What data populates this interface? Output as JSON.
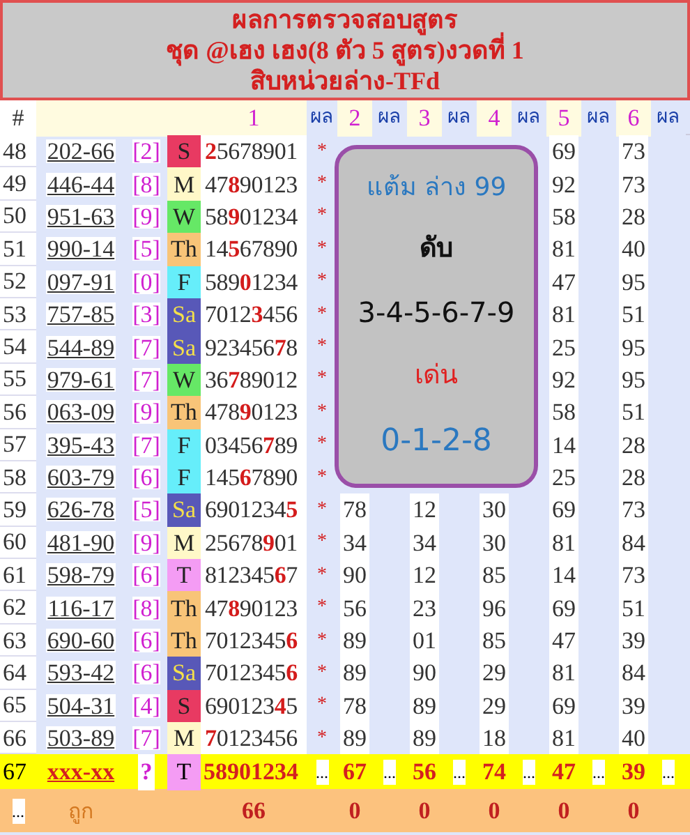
{
  "title_lines": [
    "ผลการตรวจสอบสูตร",
    "ชุด @เฮง เฮง(8 ตัว 5 สูตร)งวดที่ 1",
    "สิบหน่วยล่าง-TFd"
  ],
  "header": [
    {
      "label": "#",
      "kind": "index"
    },
    {
      "label": "1",
      "kind": "number"
    },
    {
      "label": "ผล",
      "kind": "result"
    },
    {
      "label": "2",
      "kind": "number"
    },
    {
      "label": "ผล",
      "kind": "result"
    },
    {
      "label": "3",
      "kind": "number"
    },
    {
      "label": "ผล",
      "kind": "result"
    },
    {
      "label": "4",
      "kind": "number"
    },
    {
      "label": "ผล",
      "kind": "result"
    },
    {
      "label": "5",
      "kind": "number"
    },
    {
      "label": "ผล",
      "kind": "result"
    },
    {
      "label": "6",
      "kind": "number"
    },
    {
      "label": "ผล",
      "kind": "result"
    }
  ],
  "rows": [
    {
      "no": "48",
      "pair": "202-66",
      "digit": "[2]",
      "day": {
        "label": "S",
        "color": "#e83a62"
      },
      "digits": {
        "hit": "2",
        "post": "5678901"
      },
      "mark": "*",
      "results": [
        "69",
        "73"
      ]
    },
    {
      "no": "49",
      "pair": "446-44",
      "digit": "[8]",
      "day": {
        "label": "M",
        "color": "#fff8c8"
      },
      "digits": {
        "pre": "47",
        "hit": "8",
        "post": "90123"
      },
      "mark": "*",
      "results": [
        "92",
        "73"
      ]
    },
    {
      "no": "50",
      "pair": "951-63",
      "digit": "[9]",
      "day": {
        "label": "W",
        "color": "#66e866"
      },
      "digits": {
        "pre": "58",
        "hit": "9",
        "post": "01234"
      },
      "mark": "*",
      "results": [
        "58",
        "28"
      ]
    },
    {
      "no": "51",
      "pair": "990-14",
      "digit": "[5]",
      "day": {
        "label": "Th",
        "color": "#f8c478"
      },
      "digits": {
        "pre": "14",
        "hit": "5",
        "post": "67890"
      },
      "mark": "*",
      "results": [
        "81",
        "40"
      ]
    },
    {
      "no": "52",
      "pair": "097-91",
      "digit": "[0]",
      "day": {
        "label": "F",
        "color": "#66eefa"
      },
      "digits": {
        "pre": "589",
        "hit": "0",
        "post": "1234"
      },
      "mark": "*",
      "results": [
        "47",
        "95"
      ]
    },
    {
      "no": "53",
      "pair": "757-85",
      "digit": "[3]",
      "day": {
        "label": "Sa",
        "color": "#5858b8"
      },
      "digits": {
        "pre": "7012",
        "hit": "3",
        "post": "456"
      },
      "mark": "*",
      "results": [
        "81",
        "51"
      ]
    },
    {
      "no": "54",
      "pair": "544-89",
      "digit": "[7]",
      "day": {
        "label": "Sa",
        "color": "#5858b8"
      },
      "digits": {
        "pre": "923456",
        "hit": "7",
        "post": "8"
      },
      "mark": "*",
      "results": [
        "25",
        "95"
      ]
    },
    {
      "no": "55",
      "pair": "979-61",
      "digit": "[7]",
      "day": {
        "label": "W",
        "color": "#66e866"
      },
      "digits": {
        "pre": "36",
        "hit": "7",
        "post": "89012"
      },
      "mark": "*",
      "results": [
        "92",
        "95"
      ]
    },
    {
      "no": "56",
      "pair": "063-09",
      "digit": "[9]",
      "day": {
        "label": "Th",
        "color": "#f8c478"
      },
      "digits": {
        "pre": "478",
        "hit": "9",
        "post": "0123"
      },
      "mark": "*",
      "results": [
        "58",
        "51"
      ]
    },
    {
      "no": "57",
      "pair": "395-43",
      "digit": "[7]",
      "day": {
        "label": "F",
        "color": "#66eefa"
      },
      "digits": {
        "pre": "03456",
        "hit": "7",
        "post": "89"
      },
      "mark": "*",
      "results": [
        "14",
        "28"
      ]
    },
    {
      "no": "58",
      "pair": "603-79",
      "digit": "[6]",
      "day": {
        "label": "F",
        "color": "#66eefa"
      },
      "digits": {
        "pre": "145",
        "hit": "6",
        "post": "7890"
      },
      "mark": "*",
      "results": [
        "25",
        "28"
      ]
    },
    {
      "no": "59",
      "pair": "626-78",
      "digit": "[5]",
      "day": {
        "label": "Sa",
        "color": "#5858b8"
      },
      "digits": {
        "pre": "6901234",
        "hit": "5"
      },
      "mark": "*",
      "results": [
        "78",
        "12",
        "30",
        "69",
        "73"
      ]
    },
    {
      "no": "60",
      "pair": "481-90",
      "digit": "[9]",
      "day": {
        "label": "M",
        "color": "#fff8c8"
      },
      "digits": {
        "pre": "25678",
        "hit": "9",
        "post": "01"
      },
      "mark": "*",
      "results": [
        "34",
        "34",
        "30",
        "81",
        "84"
      ]
    },
    {
      "no": "61",
      "pair": "598-79",
      "digit": "[6]",
      "day": {
        "label": "T",
        "color": "#f49cf4"
      },
      "digits": {
        "pre": "812345",
        "hit": "6",
        "post": "7"
      },
      "mark": "*",
      "results": [
        "90",
        "12",
        "85",
        "14",
        "73"
      ]
    },
    {
      "no": "62",
      "pair": "116-17",
      "digit": "[8]",
      "day": {
        "label": "Th",
        "color": "#f8c478"
      },
      "digits": {
        "pre": "47",
        "hit": "8",
        "post": "90123"
      },
      "mark": "*",
      "results": [
        "56",
        "23",
        "96",
        "69",
        "51"
      ]
    },
    {
      "no": "63",
      "pair": "690-60",
      "digit": "[6]",
      "day": {
        "label": "Th",
        "color": "#f8c478"
      },
      "digits": {
        "pre": "7012345",
        "hit": "6"
      },
      "mark": "*",
      "results": [
        "89",
        "01",
        "85",
        "47",
        "39"
      ]
    },
    {
      "no": "64",
      "pair": "593-42",
      "digit": "[6]",
      "day": {
        "label": "Sa",
        "color": "#5858b8"
      },
      "digits": {
        "pre": "7012345",
        "hit": "6"
      },
      "mark": "*",
      "results": [
        "89",
        "90",
        "29",
        "81",
        "84"
      ]
    },
    {
      "no": "65",
      "pair": "504-31",
      "digit": "[4]",
      "day": {
        "label": "S",
        "color": "#e83a62"
      },
      "digits": {
        "pre": "690123",
        "hit": "4",
        "post": "5"
      },
      "mark": "*",
      "results": [
        "78",
        "89",
        "29",
        "69",
        "39"
      ]
    },
    {
      "no": "66",
      "pair": "503-89",
      "digit": "[7]",
      "day": {
        "label": "M",
        "color": "#fff8c8"
      },
      "digits": {
        "hit": "7",
        "post": "0123456"
      },
      "mark": "*",
      "results": [
        "89",
        "89",
        "18",
        "81",
        "40"
      ]
    }
  ],
  "next_row": {
    "no": "67",
    "pair": "xxx-xx",
    "digit": "?",
    "day": {
      "label": "T",
      "color": "#f49cf4"
    },
    "digits": "58901234",
    "filler": "...",
    "results": [
      "67",
      "56",
      "74",
      "47",
      "39"
    ]
  },
  "summary": {
    "index": "...",
    "label": "ถูก",
    "total": "66",
    "counts": [
      "0",
      "0",
      "0",
      "0",
      "0"
    ]
  },
  "note": {
    "score": "แต้ม ล่าง 99",
    "off_label": "ดับ",
    "off_digits": "3-4-5-6-7-9",
    "hot_label": "เด่น",
    "hot_digits": "0-1-2-8"
  }
}
